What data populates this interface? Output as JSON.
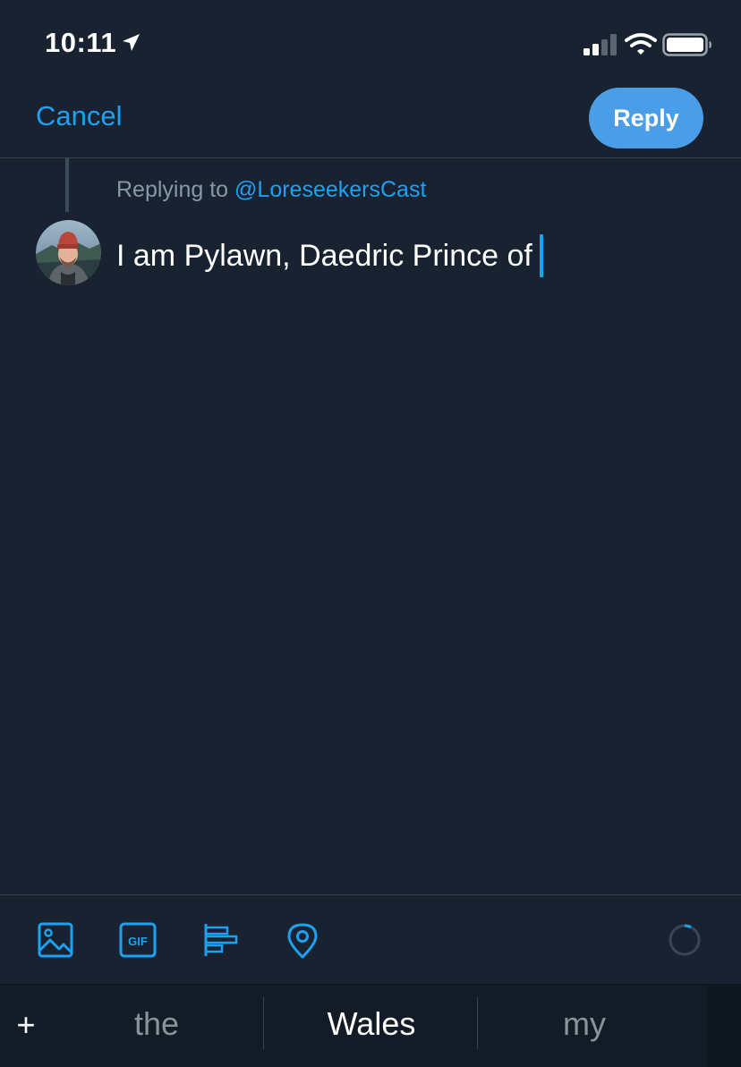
{
  "status_bar": {
    "time": "10:11",
    "icons": [
      "location-arrow-icon",
      "signal-icon",
      "wifi-icon",
      "battery-icon"
    ]
  },
  "nav": {
    "cancel_label": "Cancel",
    "reply_label": "Reply"
  },
  "compose": {
    "replying_prefix": "Replying to",
    "replying_handle": "@LoreseekersCast",
    "text": "I am Pylawn, Daedric Prince of"
  },
  "toolbar": {
    "tools": [
      "image-icon",
      "gif-icon",
      "poll-icon",
      "location-icon"
    ],
    "progress_icon": "character-count-ring-icon"
  },
  "keyboard": {
    "suggestions": [
      "the",
      "Wales",
      "my"
    ]
  },
  "colors": {
    "background": "#192230",
    "accent": "#1da1f2",
    "reply_button": "#4a9ee8",
    "muted_text": "#8899a6",
    "divider": "#38444d"
  }
}
